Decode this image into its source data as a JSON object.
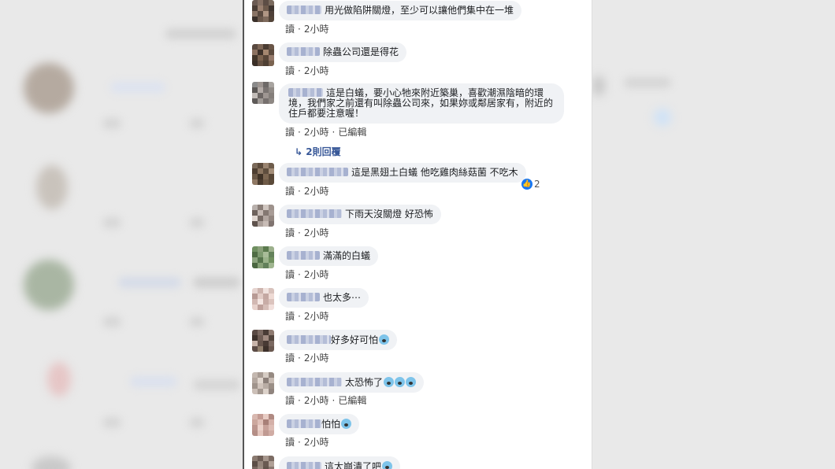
{
  "comments": [
    {
      "text": "用光做陷阱關燈，至少可以讓他們集中在一堆",
      "actions": "讀",
      "time": "2小時"
    },
    {
      "text": "除蟲公司還是得花",
      "actions": "讀",
      "time": "2小時"
    },
    {
      "text": "這是白蟻，要小心牠來附近築巢，喜歡潮濕陰暗的環境，我們家之前還有叫除蟲公司來，如果妳或鄰居家有，附近的住戶都要注意喔！",
      "actions": "讀",
      "time": "2小時",
      "edited": "已編輯",
      "replies": "2則回覆"
    },
    {
      "text": "這是黑翅土白蟻 他吃雞肉絲菇菌 不吃木",
      "actions": "讀",
      "time": "2小時",
      "reaction_count": "2"
    },
    {
      "text": "下雨天沒關燈 好恐怖",
      "actions": "讀",
      "time": "2小時"
    },
    {
      "text": "滿滿的白蟻",
      "actions": "讀",
      "time": "2小時"
    },
    {
      "text": "也太多⋯",
      "actions": "讀",
      "time": "2小時"
    },
    {
      "text": "好多好可怕",
      "actions": "讀",
      "time": "2小時",
      "emoji_count": 1
    },
    {
      "text": "太恐怖了",
      "actions": "讀",
      "time": "2小時",
      "edited": "已編輯",
      "emoji_count": 3
    },
    {
      "text": "怕怕",
      "actions": "讀",
      "time": "2小時",
      "emoji_count": 1
    },
    {
      "text": "這太崩潰了吧",
      "emoji_count": 1
    }
  ],
  "icons": {
    "reply_arrow": "reply-arrow-icon",
    "like": "like-icon",
    "emoji": "scream-emoji-icon"
  },
  "colors": {
    "bubble": "#f0f2f5",
    "link": "#385898",
    "like": "#1877f2"
  }
}
